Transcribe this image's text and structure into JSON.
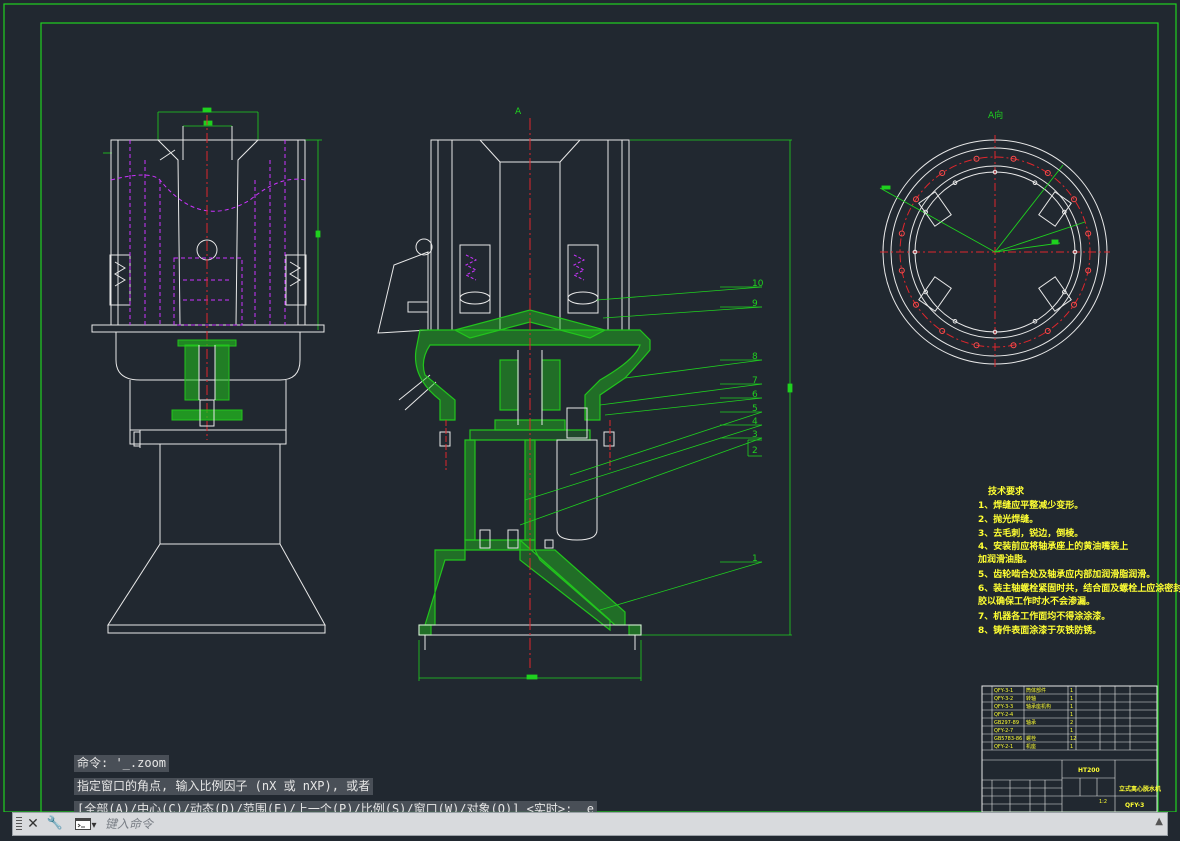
{
  "colors": {
    "background": "#212830",
    "border": "#1fd11f",
    "outline": "#e8e8e8",
    "hatch": "#22c41d",
    "center": "#e0262c",
    "hidden": "#cc33ff",
    "text": "#ffff33"
  },
  "drawing": {
    "section_label": "A",
    "view_label": "A向",
    "part_numbers": [
      "10",
      "9",
      "8",
      "7",
      "6",
      "5",
      "4",
      "3",
      "2",
      "1"
    ],
    "tech_title": "技术要求",
    "tech_notes": [
      "1、焊缝应平整减少变形。",
      "2、抛光焊缝。",
      "3、去毛刺，锐边，倒棱。",
      "4、安装前应将轴承座上的黄油嘴装上",
      "加润滑油脂。",
      "5、齿轮啮合处及轴承应内部加润滑脂润滑。",
      "6、装主轴螺栓紧固时共，结合面及螺栓上应涂密封",
      "胶以确保工作时水不会渗漏。",
      "7、机器各工作面均不得涂涂漆。",
      "8、铸件表面涂漆于灰铁防锈。"
    ],
    "title_block_rows": [
      {
        "code": "QFY-3-1",
        "name": "筒体部件",
        "qty": "1"
      },
      {
        "code": "QFY-3-2",
        "name": "转轴",
        "qty": "1"
      },
      {
        "code": "QFY-3-3",
        "name": "轴承座机构",
        "qty": "1"
      },
      {
        "code": "QFY-2-4",
        "name": "",
        "qty": "1"
      },
      {
        "code": "GB297-89",
        "name": "轴承",
        "qty": "2"
      },
      {
        "code": "QFY-2-7",
        "name": "",
        "qty": "1"
      },
      {
        "code": "GB5783-86",
        "name": "螺栓",
        "qty": "12"
      },
      {
        "code": "QFY-2-1",
        "name": "机座",
        "qty": "1"
      }
    ],
    "title_block_name": "立式离心脱水机",
    "title_block_code": "QFY-3",
    "title_block_scale": "1:2",
    "title_block_material": "HT200"
  },
  "command": {
    "history": [
      "命令: '_.zoom",
      "指定窗口的角点, 输入比例因子 (nX 或 nXP), 或者",
      "[全部(A)/中心(C)/动态(D)/范围(E)/上一个(P)/比例(S)/窗口(W)/对象(O)] <实时>: _e"
    ],
    "placeholder": "键入命令",
    "close_glyph": "✕",
    "settings_glyph": "🔧",
    "prompt_glyph": "▾",
    "scroll_glyph": "▲"
  }
}
